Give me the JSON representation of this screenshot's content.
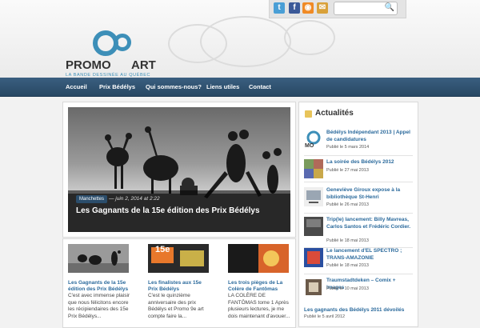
{
  "header": {
    "social": [
      {
        "name": "twitter-icon",
        "glyph": "t",
        "color": "#4a9fd6"
      },
      {
        "name": "facebook-icon",
        "glyph": "f",
        "color": "#3b5998"
      },
      {
        "name": "rss-icon",
        "glyph": "◉",
        "color": "#f08a24"
      },
      {
        "name": "email-icon",
        "glyph": "✉",
        "color": "#d9a13a"
      }
    ],
    "search_placeholder": ""
  },
  "logo": {
    "word": "PROMO",
    "art": "ART",
    "tagline": "LA BANDE DESSINÉE AU QUÉBEC"
  },
  "nav": [
    "Accueil",
    "Prix Bédélys",
    "Qui sommes-nous?",
    "Liens utiles",
    "Contact"
  ],
  "featured": {
    "tag": "Manchettes",
    "date": "— juin 2, 2014 at 2:22",
    "title": "Les Gagnants de la 15e édition des Prix Bédélys"
  },
  "posts": [
    {
      "title": "Les Gagnants de la 15e édition des Prix Bédélys",
      "excerpt": "C'est avec immense plaisir que nous félicitons encore les récipiendaires des 15e Prix Bédélys..."
    },
    {
      "title": "Les finalistes aux 15e Prix Bédélys",
      "excerpt": "C'est le quinzième anniversaire des prix Bédélys et Promo 9e art compte faire la..."
    },
    {
      "title": "Les trois pièges de La Colère de Fantômas",
      "excerpt": "LA COLÈRE DE FANTÔMAS tome 1 Après plusieurs lectures, je me dois maintenant d'avouer..."
    }
  ],
  "thumb_badge": "15e",
  "sidebar": {
    "title": "Actualités",
    "items": [
      {
        "title": "Bédélys Indépendant 2013 | Appel de candidatures",
        "date": "Publié le 5 mars 2014"
      },
      {
        "title": "La soirée des Bédélys 2012",
        "date": "Publié le 27 mai 2013"
      },
      {
        "title": "Geneviève Giroux expose à la bibliothèque St-Henri",
        "date": "Publié le 26 mai 2013"
      },
      {
        "title": "Trip(le) lancement: Billy Mavreas, Carlos Santos et Frédéric Cordier.",
        "date": "Publié le 18 mai 2013"
      },
      {
        "title": "Le lancement d'EL SPECTRO ; TRANS-AMAZONIE",
        "date": "Publié le 18 mai 2013"
      },
      {
        "title": "Traumstadtdeken – Comix + Images",
        "date": "Publié le 10 mai 2013"
      }
    ],
    "footer_title": "Les gagnants des Bédélys 2011 dévoilés",
    "footer_date": "Publié le 5 avril 2012"
  }
}
